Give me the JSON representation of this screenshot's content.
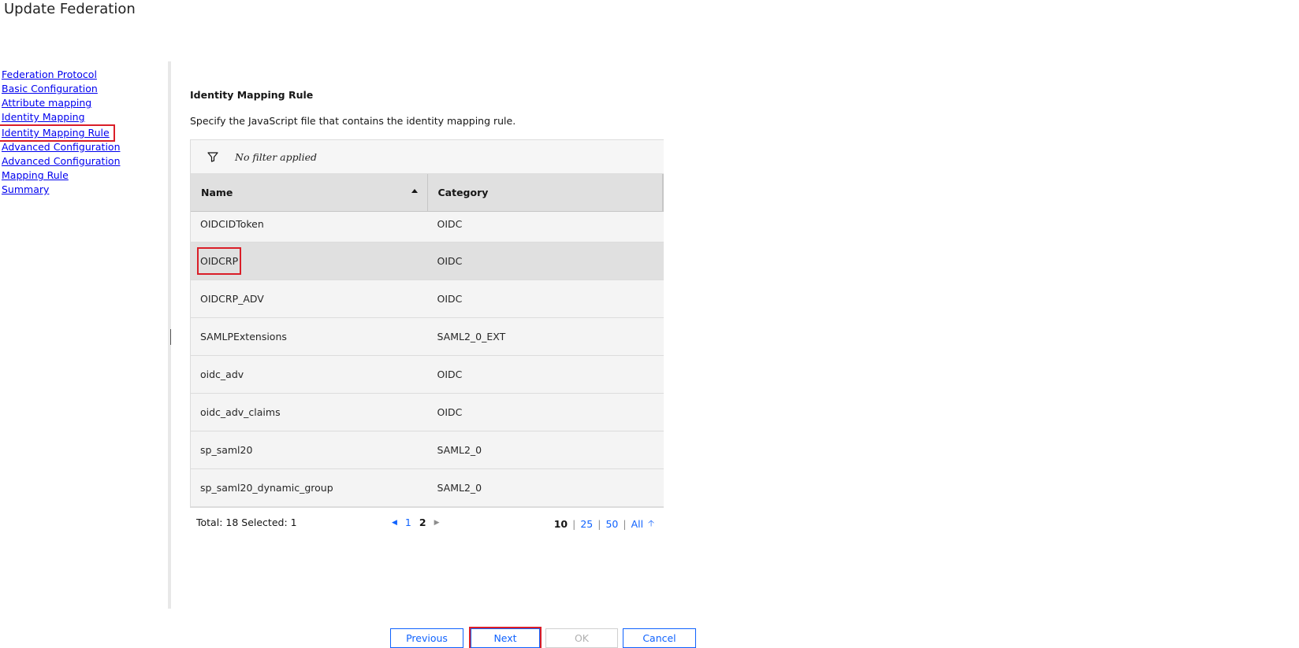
{
  "page": {
    "title": "Update Federation"
  },
  "nav": {
    "items": [
      {
        "label": "Federation Protocol",
        "current": false
      },
      {
        "label": "Basic Configuration",
        "current": false
      },
      {
        "label": "Attribute mapping",
        "current": false
      },
      {
        "label": "Identity Mapping",
        "current": false
      },
      {
        "label": "Identity Mapping Rule",
        "current": true
      },
      {
        "label": "Advanced Configuration",
        "current": false
      },
      {
        "label": "Advanced Configuration Mapping Rule",
        "current": false
      },
      {
        "label": "Summary",
        "current": false
      }
    ]
  },
  "section": {
    "heading": "Identity Mapping Rule",
    "description": "Specify the JavaScript file that contains the identity mapping rule."
  },
  "grid": {
    "filter_text": "No filter applied",
    "columns": [
      "Name",
      "Category"
    ],
    "sort": {
      "column": "Name",
      "direction": "ascending"
    },
    "rows": [
      {
        "name": "OIDCIDToken",
        "category": "OIDC",
        "selected": false
      },
      {
        "name": "OIDCRP",
        "category": "OIDC",
        "selected": true
      },
      {
        "name": "OIDCRP_ADV",
        "category": "OIDC",
        "selected": false
      },
      {
        "name": "SAMLPExtensions",
        "category": "SAML2_0_EXT",
        "selected": false
      },
      {
        "name": "oidc_adv",
        "category": "OIDC",
        "selected": false
      },
      {
        "name": "oidc_adv_claims",
        "category": "OIDC",
        "selected": false
      },
      {
        "name": "sp_saml20",
        "category": "SAML2_0",
        "selected": false
      },
      {
        "name": "sp_saml20_dynamic_group",
        "category": "SAML2_0",
        "selected": false
      }
    ],
    "footer": {
      "status": "Total: 18 Selected: 1",
      "pages": [
        "1",
        "2"
      ],
      "current_page": "2",
      "page_sizes": [
        "10",
        "25",
        "50",
        "All"
      ],
      "current_page_size": "10"
    }
  },
  "buttons": {
    "previous": "Previous",
    "next": "Next",
    "ok": "OK",
    "cancel": "Cancel"
  },
  "colors": {
    "link": "#0000ee",
    "accent": "#0f62fe",
    "highlight_outline": "#da1e28"
  }
}
